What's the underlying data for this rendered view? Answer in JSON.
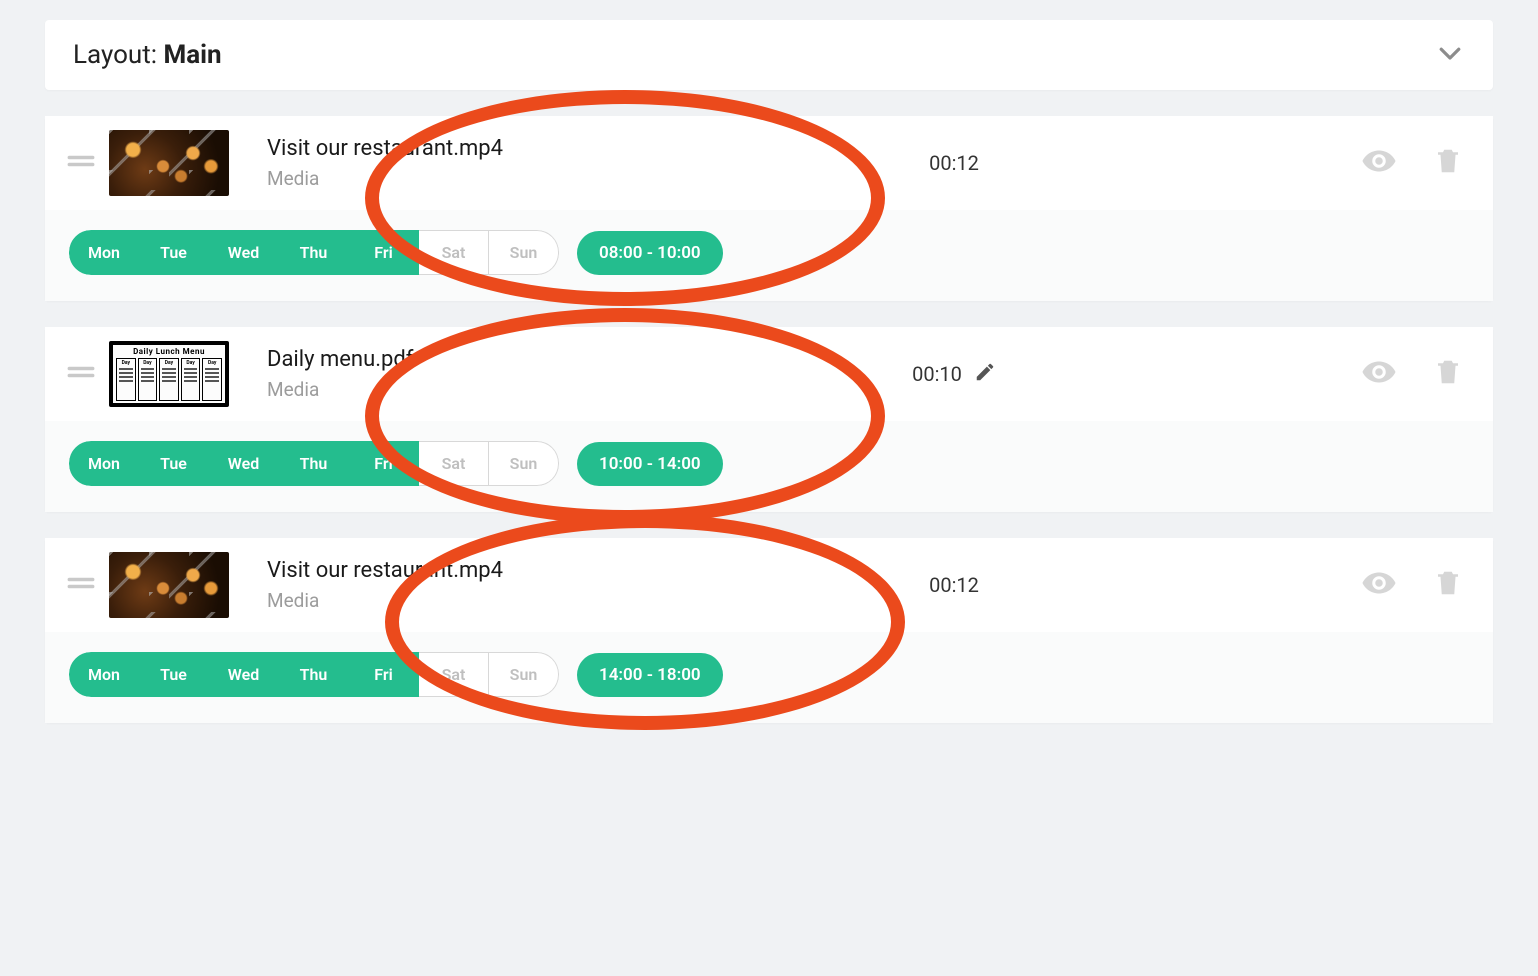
{
  "header": {
    "prefix": "Layout: ",
    "name": "Main"
  },
  "days": [
    "Mon",
    "Tue",
    "Wed",
    "Thu",
    "Fri",
    "Sat",
    "Sun"
  ],
  "items": [
    {
      "title": "Visit our restaurant.mp4",
      "type": "Media",
      "duration": "00:12",
      "show_edit": false,
      "thumb": "food",
      "active_days": [
        true,
        true,
        true,
        true,
        true,
        false,
        false
      ],
      "time": "08:00 - 10:00"
    },
    {
      "title": "Daily menu.pdf",
      "type": "Media",
      "duration": "00:10",
      "show_edit": true,
      "thumb": "menu",
      "active_days": [
        true,
        true,
        true,
        true,
        true,
        false,
        false
      ],
      "time": "10:00 - 14:00"
    },
    {
      "title": "Visit our restaurant.mp4",
      "type": "Media",
      "duration": "00:12",
      "show_edit": false,
      "thumb": "food",
      "active_days": [
        true,
        true,
        true,
        true,
        true,
        false,
        false
      ],
      "time": "14:00 - 18:00"
    }
  ],
  "annotation_color": "#eb4a1c"
}
